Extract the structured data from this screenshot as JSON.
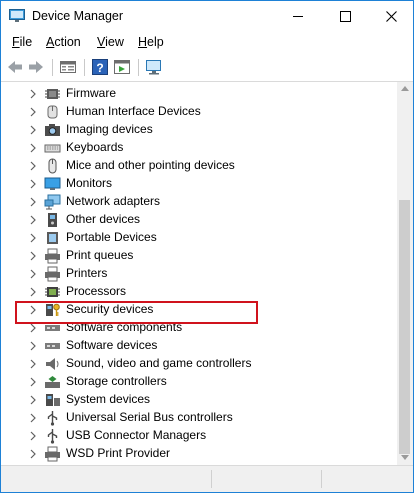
{
  "window": {
    "title": "Device Manager"
  },
  "menu": [
    {
      "label": "File",
      "accel": "F",
      "rest": "ile"
    },
    {
      "label": "Action",
      "accel": "A",
      "rest": "ction"
    },
    {
      "label": "View",
      "accel": "V",
      "rest": "iew"
    },
    {
      "label": "Help",
      "accel": "H",
      "rest": "elp"
    }
  ],
  "toolbar": [
    "back-icon",
    "forward-icon",
    "properties-icon",
    "help-icon",
    "run-icon",
    "monitor-icon"
  ],
  "tree": {
    "items": [
      {
        "label": "Firmware",
        "icon": "firmware-icon"
      },
      {
        "label": "Human Interface Devices",
        "icon": "hid-icon"
      },
      {
        "label": "Imaging devices",
        "icon": "camera-icon"
      },
      {
        "label": "Keyboards",
        "icon": "keyboard-icon"
      },
      {
        "label": "Mice and other pointing devices",
        "icon": "mouse-icon"
      },
      {
        "label": "Monitors",
        "icon": "monitor-icon"
      },
      {
        "label": "Network adapters",
        "icon": "network-icon"
      },
      {
        "label": "Other devices",
        "icon": "other-device-icon"
      },
      {
        "label": "Portable Devices",
        "icon": "portable-device-icon"
      },
      {
        "label": "Print queues",
        "icon": "print-queue-icon"
      },
      {
        "label": "Printers",
        "icon": "printer-icon"
      },
      {
        "label": "Processors",
        "icon": "processor-icon"
      },
      {
        "label": "Security devices",
        "icon": "security-key-icon",
        "highlighted": true
      },
      {
        "label": "Software components",
        "icon": "software-component-icon"
      },
      {
        "label": "Software devices",
        "icon": "software-device-icon"
      },
      {
        "label": "Sound, video and game controllers",
        "icon": "speaker-icon"
      },
      {
        "label": "Storage controllers",
        "icon": "storage-controller-icon"
      },
      {
        "label": "System devices",
        "icon": "system-device-icon"
      },
      {
        "label": "Universal Serial Bus controllers",
        "icon": "usb-icon"
      },
      {
        "label": "USB Connector Managers",
        "icon": "usb-connector-icon"
      },
      {
        "label": "WSD Print Provider",
        "icon": "wsd-printer-icon"
      }
    ]
  },
  "colors": {
    "accent": "#1e81d6",
    "highlight": "#d0131d"
  }
}
